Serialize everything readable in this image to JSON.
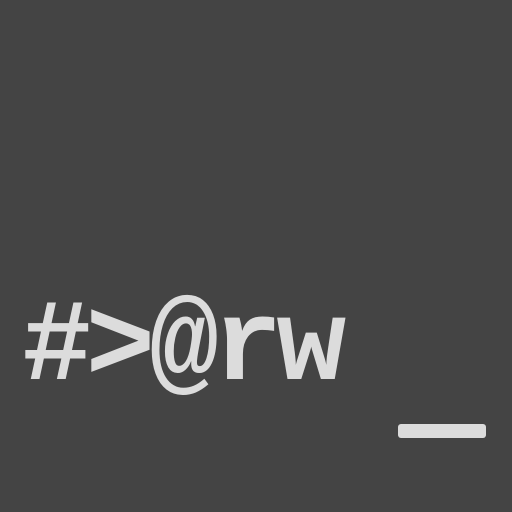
{
  "logo": {
    "text": "#>@rw",
    "cursor": "_",
    "background_color": "#444444",
    "foreground_color": "#dcdcdc"
  }
}
